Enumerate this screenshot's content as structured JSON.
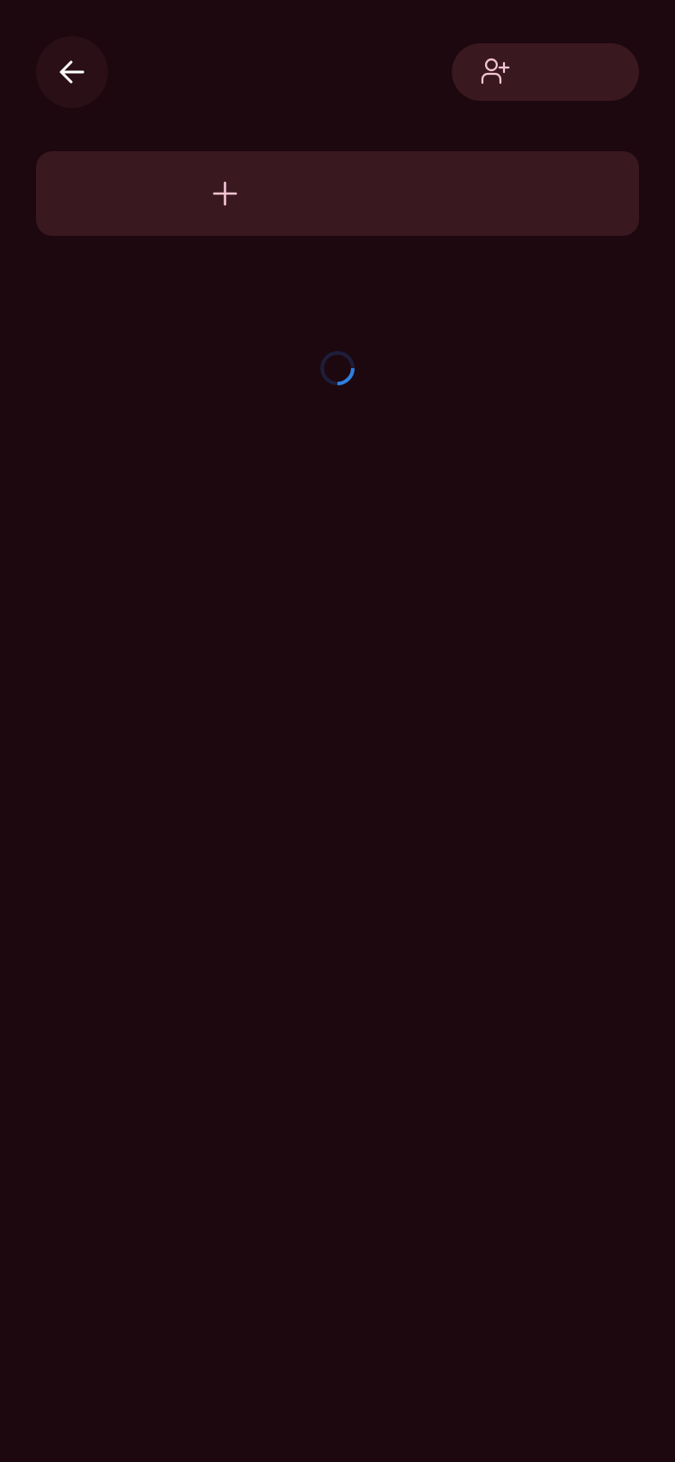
{
  "header": {
    "back_icon": "arrow-left-icon",
    "invite_icon": "user-plus-icon",
    "invite_label": ""
  },
  "add_card": {
    "icon": "plus-icon",
    "label": ""
  },
  "loading": {
    "icon": "loading-spinner"
  },
  "colors": {
    "background": "#1c080e",
    "surface": "#3a1820",
    "back_button_bg": "#2a0f16",
    "icon_pink": "#f3c4d4",
    "back_icon_color": "#ffffff",
    "spinner_track": "#1e1e3a",
    "spinner_arc": "#2f7fe0"
  }
}
